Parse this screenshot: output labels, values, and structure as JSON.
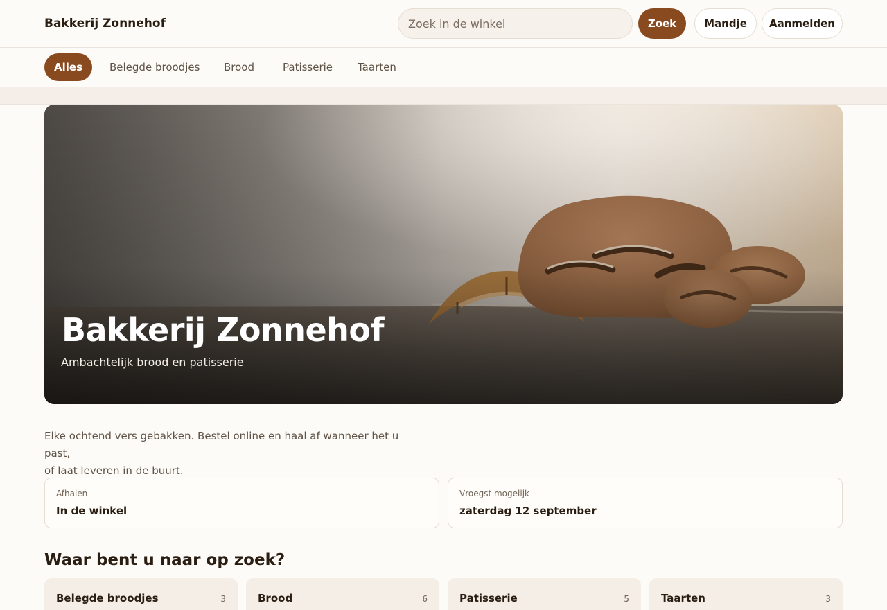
{
  "header": {
    "brand": "Bakkerij Zonnehof",
    "search_placeholder": "Zoek in de winkel",
    "search_button": "Zoek",
    "cart_button": "Mandje",
    "login_button": "Aanmelden"
  },
  "categories_nav": [
    {
      "label": "Alles",
      "active": true
    },
    {
      "label": "Belegde broodjes",
      "active": false
    },
    {
      "label": "Brood",
      "active": false
    },
    {
      "label": "Patisserie",
      "active": false
    },
    {
      "label": "Taarten",
      "active": false
    }
  ],
  "hero": {
    "title": "Bakkerij Zonnehof",
    "subtitle": "Ambachtelijk brood en patisserie"
  },
  "intro": {
    "line1": "Elke ochtend vers gebakken. Bestel online en haal af wanneer het u past,",
    "line2": "of laat leveren in de buurt."
  },
  "info_cards": [
    {
      "label": "Afhalen",
      "value": "In de winkel"
    },
    {
      "label": "Vroegst mogelijk",
      "value": "zaterdag 12 september"
    }
  ],
  "section_title": "Waar bent u naar op zoek?",
  "category_cards": [
    {
      "name": "Belegde broodjes",
      "count": "3"
    },
    {
      "name": "Brood",
      "count": "6"
    },
    {
      "name": "Patisserie",
      "count": "5"
    },
    {
      "name": "Taarten",
      "count": "3"
    }
  ],
  "colors": {
    "accent": "#8a4a1f",
    "background": "#fdfbf7",
    "card": "#f5eee7"
  }
}
